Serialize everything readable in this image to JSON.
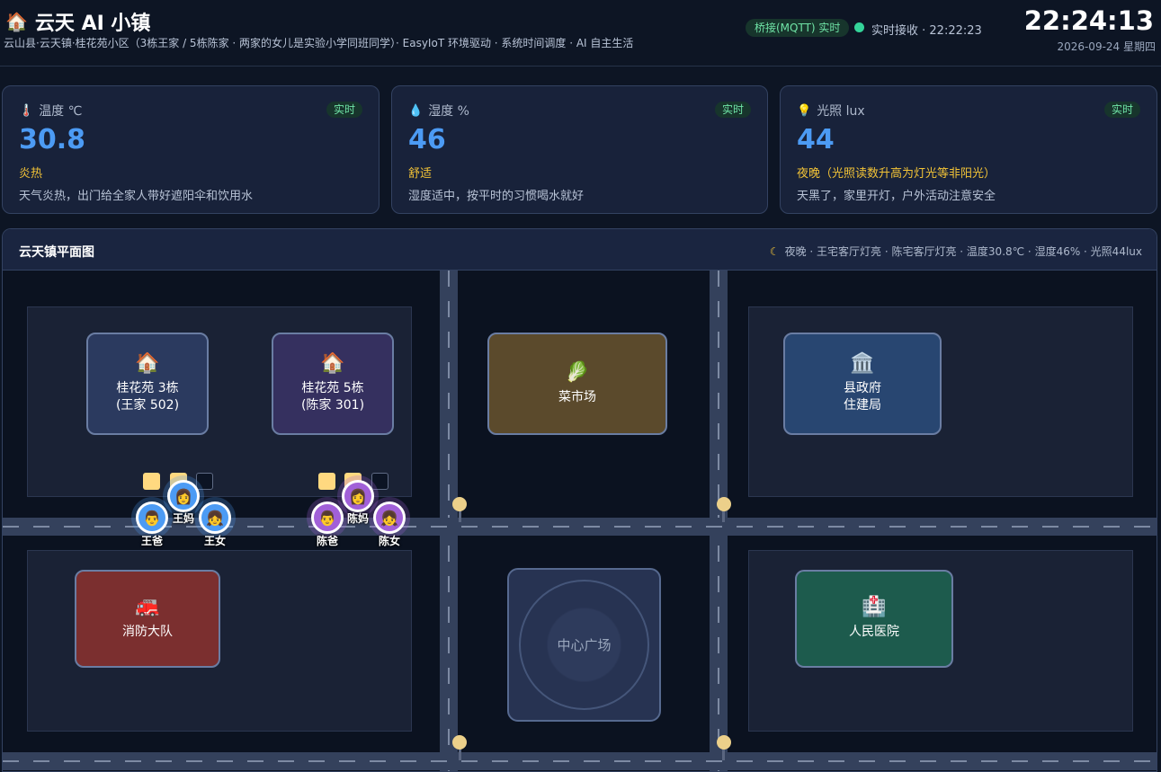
{
  "header": {
    "title": "云天 AI 小镇",
    "title_icon": "house-icon",
    "subtitle": "云山县·云天镇·桂花苑小区（3栋王家 / 5栋陈家 · 两家的女儿是实验小学同班同学）· EasyIoT 环境驱动 · 系统时间调度 · AI 自主生活",
    "bridge_badge": "桥接(MQTT) 实时",
    "receive_status": "实时接收 · 22:22:23",
    "live_color": "#34d399",
    "clock": "22:24:13",
    "date": "2026-09-24 星期四"
  },
  "sensors": [
    {
      "icon": "thermometer-icon",
      "label": "温度 ℃",
      "badge": "实时",
      "value": "30.8",
      "status": "炎热",
      "desc": "天气炎热，出门给全家人带好遮阳伞和饮用水"
    },
    {
      "icon": "droplet-icon",
      "label": "湿度 %",
      "badge": "实时",
      "value": "46",
      "status": "舒适",
      "desc": "湿度适中，按平时的习惯喝水就好"
    },
    {
      "icon": "lightbulb-icon",
      "label": "光照 lux",
      "badge": "实时",
      "value": "44",
      "status": "夜晚（光照读数升高为灯光等非阳光）",
      "desc": "天黑了，家里开灯，户外活动注意安全"
    }
  ],
  "map": {
    "title": "云天镇平面图",
    "info": "夜晚 · 王宅客厅灯亮 · 陈宅客厅灯亮 · 温度30.8℃ · 湿度46% · 光照44lux",
    "buildings": {
      "wang_home": {
        "icon": "house-icon",
        "line1": "桂花苑 3栋",
        "line2": "(王家 502)"
      },
      "chen_home": {
        "icon": "house-icon",
        "line1": "桂花苑 5栋",
        "line2": "(陈家 301)"
      },
      "market": {
        "icon": "vegetable-icon",
        "line1": "菜市场"
      },
      "government": {
        "icon": "government-building-icon",
        "line1": "县政府",
        "line2": "住建局"
      },
      "fire_station": {
        "icon": "fire-engine-icon",
        "line1": "消防大队"
      },
      "plaza": {
        "line1": "中心广场"
      },
      "hospital": {
        "icon": "hospital-icon",
        "line1": "人民医院"
      }
    },
    "residents": [
      {
        "name": "王妈",
        "family": "wang",
        "icon": "woman-farmer-icon"
      },
      {
        "name": "王爸",
        "family": "wang",
        "icon": "man-office-worker-icon"
      },
      {
        "name": "王女",
        "family": "wang",
        "icon": "child-icon"
      },
      {
        "name": "陈妈",
        "family": "chen",
        "icon": "woman-doctor-icon"
      },
      {
        "name": "陈爸",
        "family": "chen",
        "icon": "firefighter-icon"
      },
      {
        "name": "陈女",
        "family": "chen",
        "icon": "child-icon"
      }
    ]
  },
  "colors": {
    "accent_blue": "#4c9bf4",
    "status_yellow": "#f2c337",
    "wang_color": "#4c9bf4",
    "chen_color": "#a160d8"
  }
}
